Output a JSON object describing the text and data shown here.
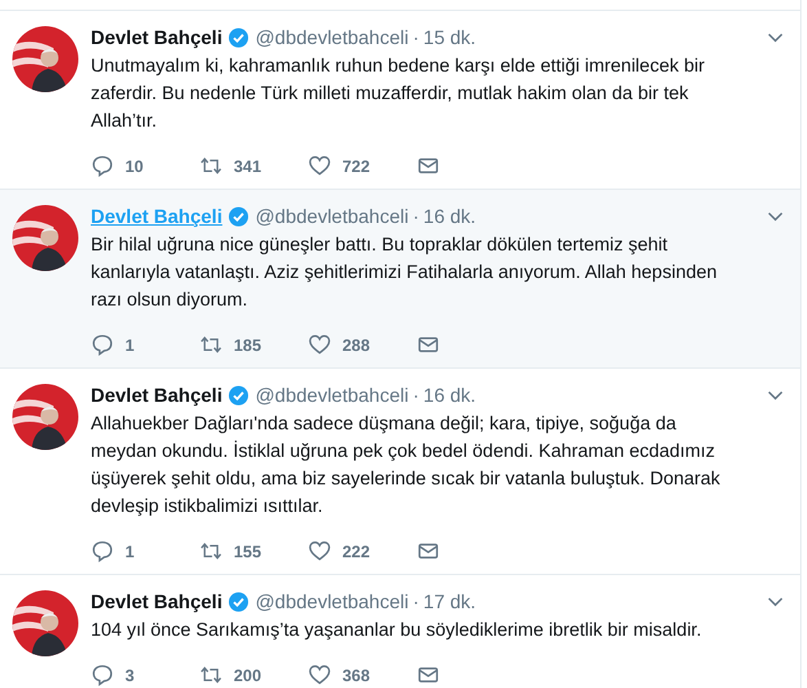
{
  "tweets": [
    {
      "name": "Devlet Bahçeli",
      "handle": "@dbdevletbahceli",
      "separator": "·",
      "time": "15 dk.",
      "text": "Unutmayalım ki, kahramanlık ruhun bedene karşı elde ettiği imrenilecek bir zaferdir. Bu nedenle Türk milleti muzafferdir, mutlak hakim olan da bir tek Allah’tır.",
      "verified": true,
      "hovered": false,
      "replies": "10",
      "retweets": "341",
      "likes": "722"
    },
    {
      "name": "Devlet Bahçeli",
      "handle": "@dbdevletbahceli",
      "separator": "·",
      "time": "16 dk.",
      "text": "Bir hilal uğruna nice güneşler battı. Bu topraklar dökülen tertemiz şehit kanlarıyla vatanlaştı. Aziz şehitlerimizi Fatihalarla anıyorum. Allah hepsinden razı olsun diyorum.",
      "verified": true,
      "hovered": true,
      "replies": "1",
      "retweets": "185",
      "likes": "288"
    },
    {
      "name": "Devlet Bahçeli",
      "handle": "@dbdevletbahceli",
      "separator": "·",
      "time": "16 dk.",
      "text": "Allahuekber Dağları'nda sadece düşmana değil; kara, tipiye, soğuğa da meydan okundu. İstiklal uğruna pek çok bedel ödendi. Kahraman ecdadımız üşüyerek şehit oldu, ama biz sayelerinde sıcak bir vatanla buluştuk. Donarak devleşip istikbalimizi ısıttılar.",
      "verified": true,
      "hovered": false,
      "replies": "1",
      "retweets": "155",
      "likes": "222"
    },
    {
      "name": "Devlet Bahçeli",
      "handle": "@dbdevletbahceli",
      "separator": "·",
      "time": "17 dk.",
      "text": "104 yıl önce Sarıkamış’ta yaşananlar bu söylediklerime ibretlik bir misaldir.",
      "verified": true,
      "hovered": false,
      "replies": "3",
      "retweets": "200",
      "likes": "368"
    }
  ]
}
